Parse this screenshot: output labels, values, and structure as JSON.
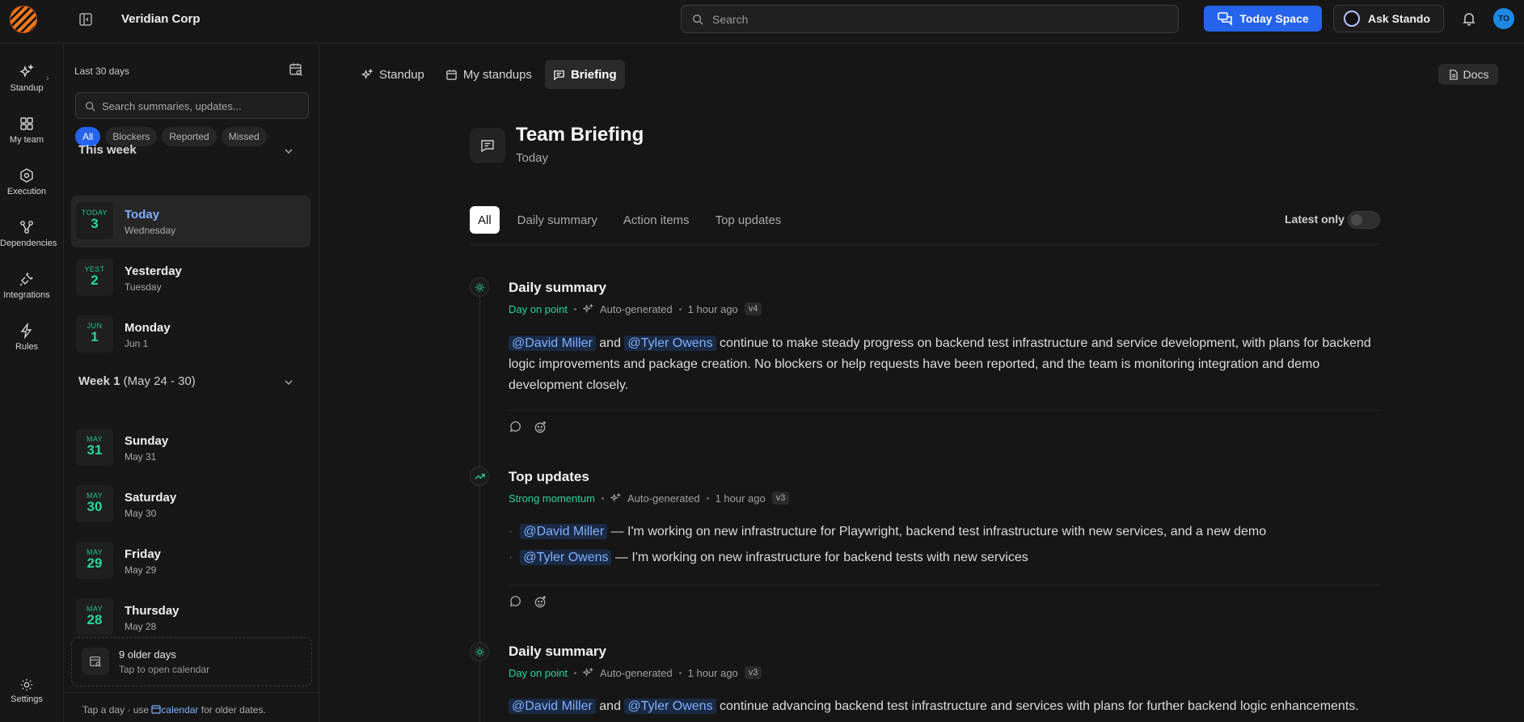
{
  "header": {
    "org_name": "Veridian Corp",
    "search_placeholder": "Search",
    "today_space_label": "Today Space",
    "ask_label": "Ask Stando",
    "avatar_initials": "TO"
  },
  "rail": {
    "items": [
      {
        "label": "Standup",
        "icon": "sparkles-icon"
      },
      {
        "label": "My team",
        "icon": "grid-icon"
      },
      {
        "label": "Execution",
        "icon": "hexagon-icon"
      },
      {
        "label": "Dependencies",
        "icon": "dependencies-icon"
      },
      {
        "label": "Integrations",
        "icon": "plug-icon"
      },
      {
        "label": "Rules",
        "icon": "bolt-icon"
      }
    ],
    "settings_label": "Settings"
  },
  "left_panel": {
    "range_label": "Last 30 days",
    "search_placeholder": "Search summaries, updates...",
    "chips": [
      "All",
      "Blockers",
      "Reported",
      "Missed"
    ],
    "this_week_label": "This week",
    "this_week_days": [
      {
        "tag": "TODAY",
        "num": "3",
        "name": "Today",
        "sub": "Wednesday"
      },
      {
        "tag": "YEST",
        "num": "2",
        "name": "Yesterday",
        "sub": "Tuesday"
      },
      {
        "tag": "JUN",
        "num": "1",
        "name": "Monday",
        "sub": "Jun 1"
      }
    ],
    "week1_label": "Week 1",
    "week1_range": "(May 24 - 30)",
    "week1_days": [
      {
        "tag": "MAY",
        "num": "31",
        "name": "Sunday",
        "sub": "May 31"
      },
      {
        "tag": "MAY",
        "num": "30",
        "name": "Saturday",
        "sub": "May 30"
      },
      {
        "tag": "MAY",
        "num": "29",
        "name": "Friday",
        "sub": "May 29"
      },
      {
        "tag": "MAY",
        "num": "28",
        "name": "Thursday",
        "sub": "May 28"
      }
    ],
    "older_title": "9 older days",
    "older_sub": "Tap to open calendar",
    "footer_pre": "Tap a day · use ",
    "footer_link": "calendar",
    "footer_post": " for older dates."
  },
  "main": {
    "tabs": [
      "Standup",
      "My standups",
      "Briefing"
    ],
    "docs_label": "Docs",
    "title": "Team Briefing",
    "subtitle": "Today",
    "filters": [
      "All",
      "Daily summary",
      "Action items",
      "Top updates"
    ],
    "latest_label": "Latest only",
    "entries": [
      {
        "title": "Daily summary",
        "status": "Day on point",
        "source": "Auto-generated",
        "time": "1 hour ago",
        "version": "v4",
        "mention1": "@David Miller",
        "and": "and",
        "mention2": "@Tyler Owens",
        "text": "continue to make steady progress on backend test infrastructure and service development, with plans for backend logic improvements and package creation. No blockers or help requests have been reported, and the team is monitoring integration and demo development closely."
      },
      {
        "title": "Top updates",
        "status": "Strong momentum",
        "source": "Auto-generated",
        "time": "1 hour ago",
        "version": "v3",
        "bullets": [
          {
            "mention": "@David Miller",
            "text": "— I'm working on new infrastructure for Playwright, backend test infrastructure with new services, and a new demo"
          },
          {
            "mention": "@Tyler Owens",
            "text": "— I'm working on new infrastructure for backend tests with new services"
          }
        ]
      },
      {
        "title": "Daily summary",
        "status": "Day on point",
        "source": "Auto-generated",
        "time": "1 hour ago",
        "version": "v3",
        "mention1": "@David Miller",
        "and": "and",
        "mention2": "@Tyler Owens",
        "text": "continue advancing backend test infrastructure and services with plans for further backend logic enhancements."
      }
    ]
  },
  "colors": {
    "accent": "#2563eb",
    "status_green": "#2bd59a",
    "mention_blue": "#7fb0ff",
    "background": "#161616"
  }
}
